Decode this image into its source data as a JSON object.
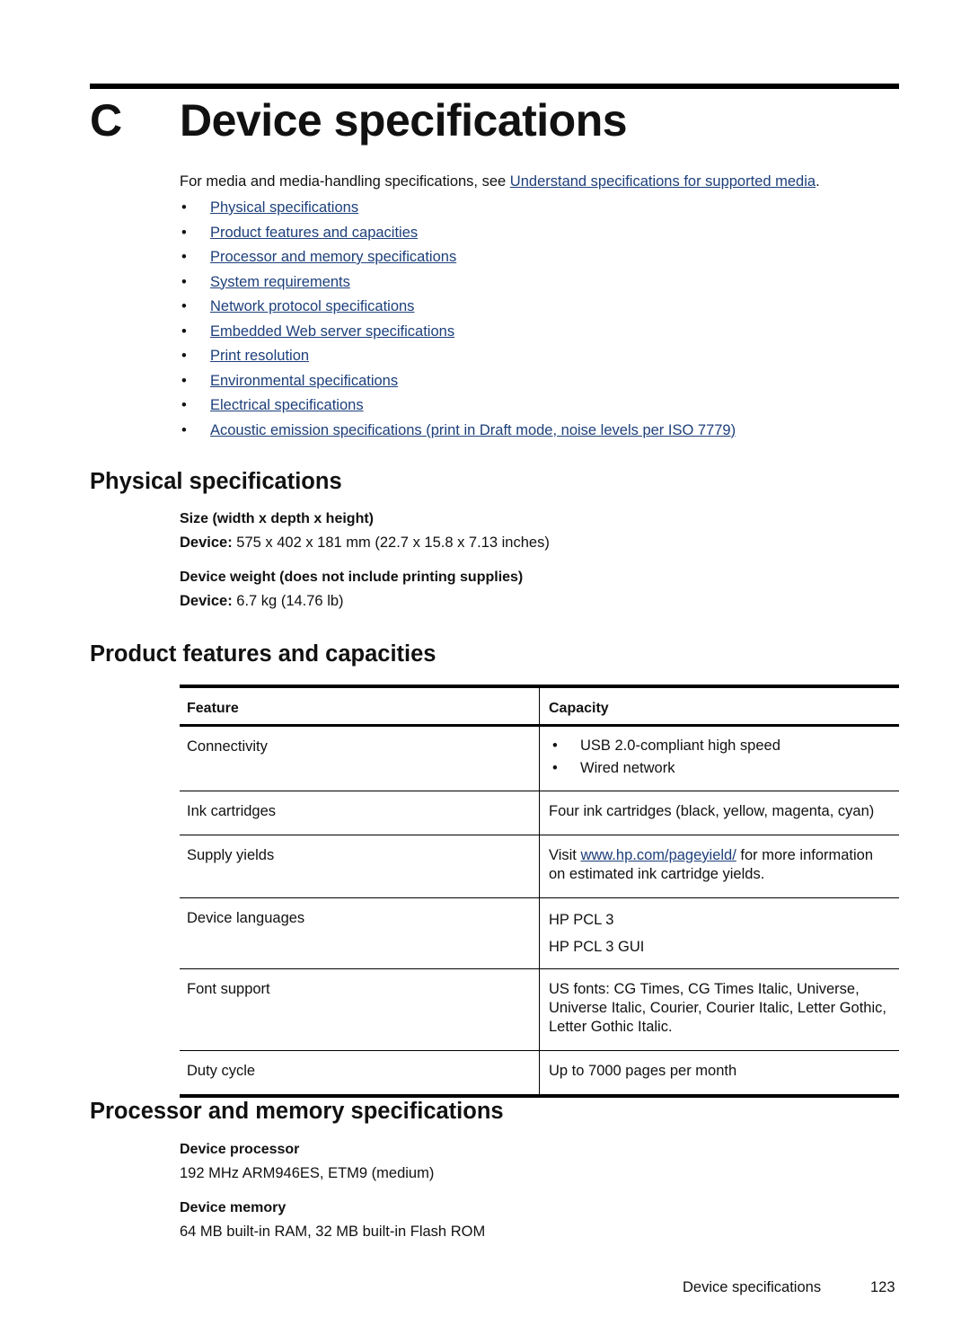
{
  "chapter": {
    "letter": "C",
    "title": "Device specifications"
  },
  "intro": {
    "text_before": "For media and media-handling specifications, see ",
    "link_text": "Understand specifications for supported media",
    "text_after": "."
  },
  "toc": [
    {
      "bullet": "•",
      "label": "Physical specifications"
    },
    {
      "bullet": "•",
      "label": "Product features and capacities"
    },
    {
      "bullet": "•",
      "label": "Processor and memory specifications"
    },
    {
      "bullet": "•",
      "label": "System requirements"
    },
    {
      "bullet": "•",
      "label": "Network protocol specifications"
    },
    {
      "bullet": "•",
      "label": "Embedded Web server specifications"
    },
    {
      "bullet": "•",
      "label": "Print resolution"
    },
    {
      "bullet": "•",
      "label": "Environmental specifications"
    },
    {
      "bullet": "•",
      "label": "Electrical specifications"
    },
    {
      "bullet": "•",
      "label": "Acoustic emission specifications (print in Draft mode, noise levels per ISO 7779)"
    }
  ],
  "physical": {
    "heading": "Physical specifications",
    "size_heading": "Size (width x depth x height)",
    "size_label": "Device:",
    "size_value": " 575 x 402 x 181 mm (22.7 x 15.8 x 7.13 inches)",
    "weight_heading": "Device weight (does not include printing supplies)",
    "weight_label": "Device:",
    "weight_value": " 6.7 kg (14.76 lb)"
  },
  "features": {
    "heading": "Product features and capacities",
    "columns": [
      "Feature",
      "Capacity"
    ],
    "rows": {
      "connectivity": {
        "feature": "Connectivity",
        "bullet": "•",
        "items": [
          "USB 2.0-compliant high speed",
          "Wired network"
        ]
      },
      "ink": {
        "feature": "Ink cartridges",
        "capacity": "Four ink cartridges (black, yellow, magenta, cyan)"
      },
      "yields": {
        "feature": "Supply yields",
        "text_before": "Visit ",
        "link_text": "www.hp.com/pageyield/",
        "text_after": " for more information on estimated ink cartridge yields."
      },
      "languages": {
        "feature": "Device languages",
        "lines": [
          "HP PCL 3",
          "HP PCL 3 GUI"
        ]
      },
      "fonts": {
        "feature": "Font support",
        "capacity": "US fonts: CG Times, CG Times Italic, Universe, Universe Italic, Courier, Courier Italic, Letter Gothic, Letter Gothic Italic."
      },
      "duty": {
        "feature": "Duty cycle",
        "capacity": "Up to 7000 pages per month"
      }
    }
  },
  "processor": {
    "heading": "Processor and memory specifications",
    "proc_heading": "Device processor",
    "proc_value": "192 MHz ARM946ES, ETM9 (medium)",
    "mem_heading": "Device memory",
    "mem_value": "64 MB built-in RAM, 32 MB built-in Flash ROM"
  },
  "footer": {
    "section": "Device specifications",
    "page": "123"
  },
  "colors": {
    "link": "#1d3f7a",
    "text": "#111111",
    "rule": "#000000"
  }
}
